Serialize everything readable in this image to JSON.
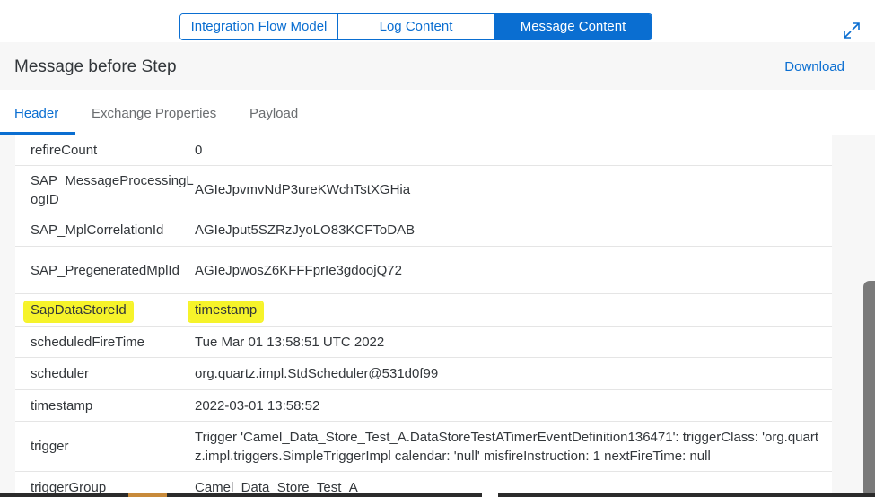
{
  "segmented": {
    "items": [
      "Integration Flow Model",
      "Log Content",
      "Message Content"
    ],
    "active_index": 2
  },
  "header": {
    "title": "Message before Step",
    "download_label": "Download"
  },
  "tabs": {
    "items": [
      "Header",
      "Exchange Properties",
      "Payload"
    ],
    "active_index": 0
  },
  "table": {
    "rows": [
      {
        "key": "refireCount",
        "value": "0"
      },
      {
        "key": "SAP_MessageProcessingLogID",
        "value": "AGIeJpvmvNdP3ureKWchTstXGHia"
      },
      {
        "key": "SAP_MplCorrelationId",
        "value": "AGIeJput5SZRzJyoLO83KCFToDAB"
      },
      {
        "key": "SAP_PregeneratedMplId",
        "value": "AGIeJpwosZ6KFFFprIe3gdoojQ72"
      },
      {
        "key": "SapDataStoreId",
        "value": "timestamp",
        "highlighted": true
      },
      {
        "key": "scheduledFireTime",
        "value": "Tue Mar 01 13:58:51 UTC 2022"
      },
      {
        "key": "scheduler",
        "value": "org.quartz.impl.StdScheduler@531d0f99"
      },
      {
        "key": "timestamp",
        "value": "2022-03-01 13:58:52"
      },
      {
        "key": "trigger",
        "value": "Trigger 'Camel_Data_Store_Test_A.DataStoreTestATimerEventDefinition136471':  triggerClass: 'org.quartz.impl.triggers.SimpleTriggerImpl calendar: 'null' misfireInstruction: 1 nextFireTime: null"
      },
      {
        "key": "triggerGroup",
        "value": "Camel_Data_Store_Test_A"
      }
    ]
  },
  "colors": {
    "accent": "#0a6ed1",
    "highlight": "#f6f32a"
  }
}
